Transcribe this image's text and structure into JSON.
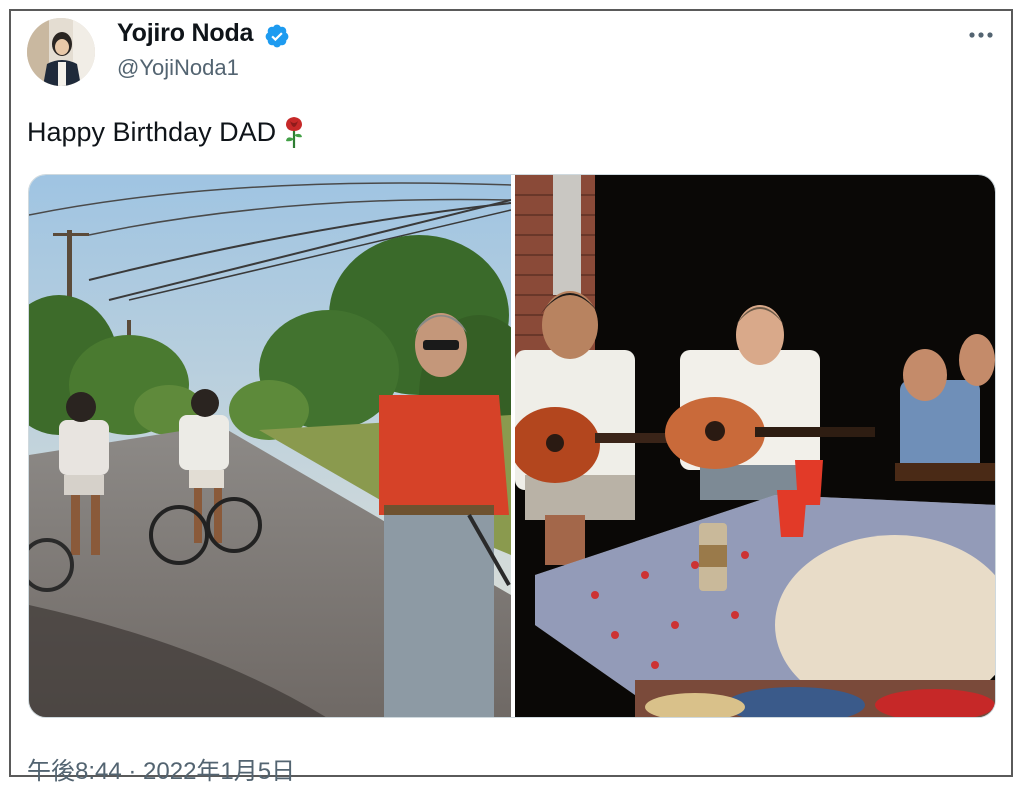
{
  "author": {
    "display_name": "Yojiro Noda",
    "handle": "@YojiNoda1",
    "verified": true,
    "avatar_icon": "user-avatar"
  },
  "tweet": {
    "text": "Happy Birthday DAD",
    "emoji": "rose-icon",
    "timestamp": "午後8:44 · 2022年1月5日"
  },
  "menu": {
    "icon": "more-options-icon"
  },
  "media": {
    "count": 2,
    "photos": [
      {
        "description_icon": "photo-road-bicycles"
      },
      {
        "description_icon": "photo-guitar-party"
      }
    ]
  },
  "colors": {
    "verified_blue": "#1d9bf0",
    "handle_gray": "#536471",
    "text_black": "#0f1419",
    "border": "#5a5a5a"
  }
}
